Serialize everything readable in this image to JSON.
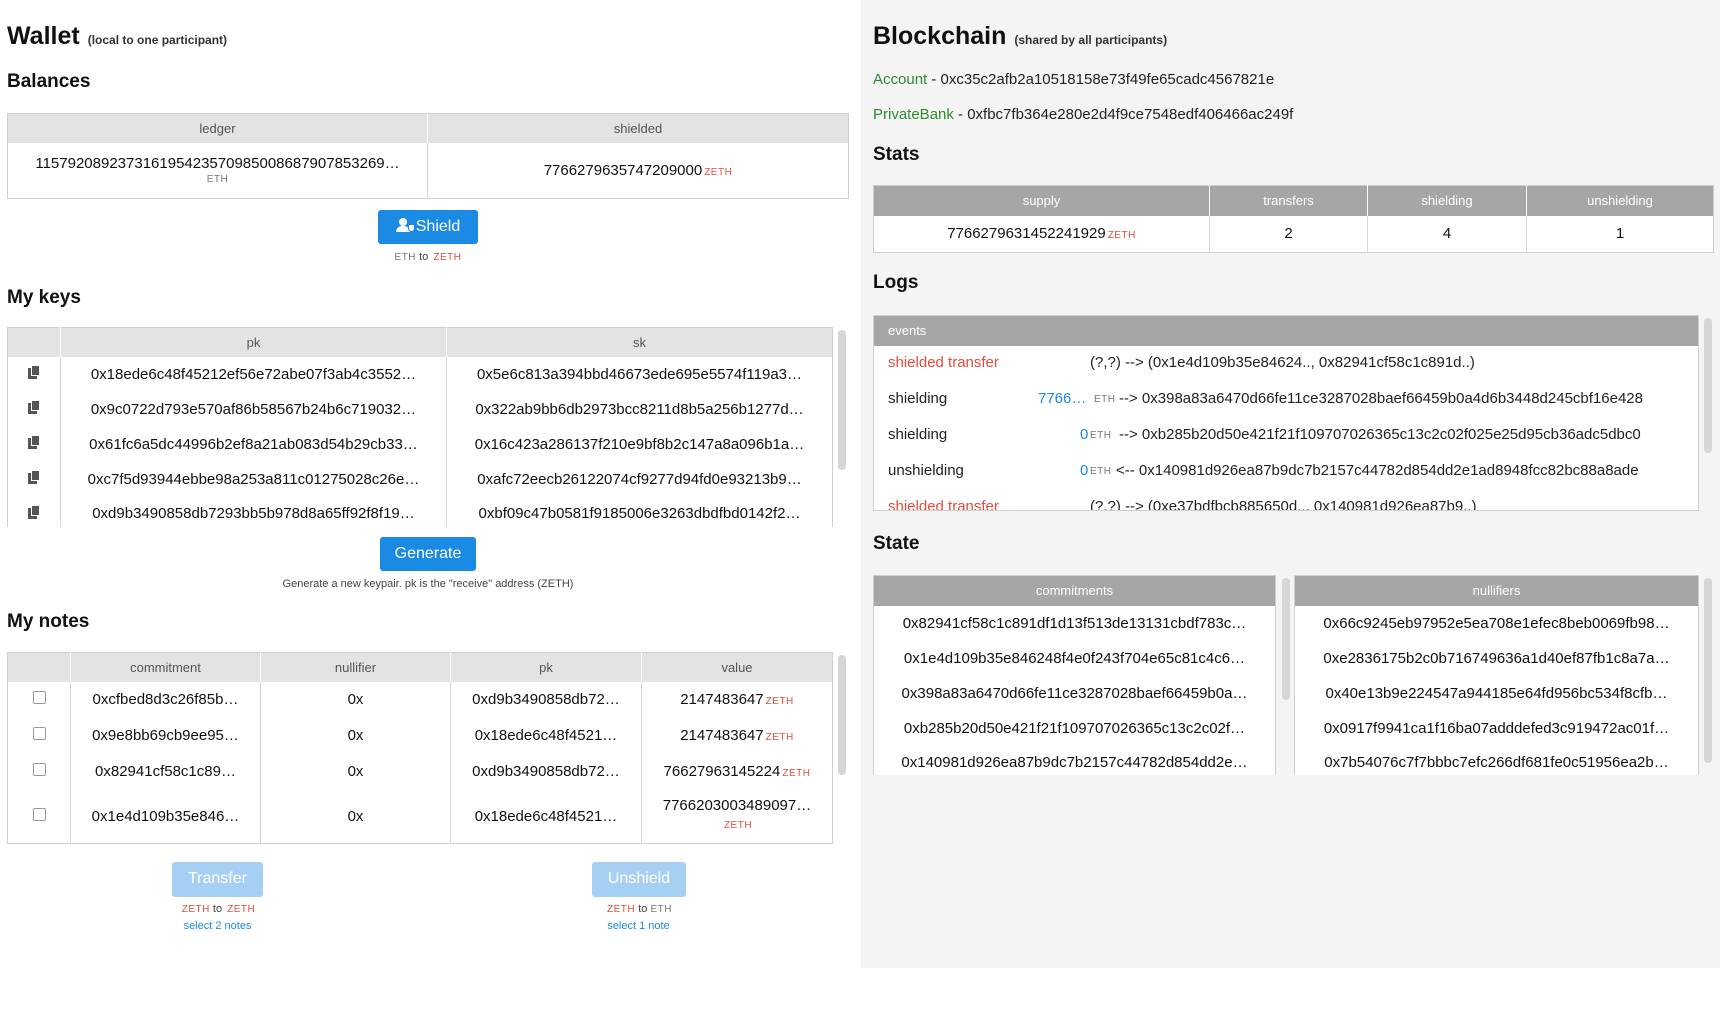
{
  "wallet": {
    "title": "Wallet",
    "subtitle": "(local to one participant)",
    "balances_title": "Balances",
    "balances_headers": [
      "ledger",
      "shielded"
    ],
    "ledger_value": "115792089237316195423570985008687907853269…",
    "ledger_unit": "ETH",
    "shielded_value": "7766279635747209000",
    "shielded_unit": "ZETH",
    "shield_button": "Shield",
    "shield_caption_from": "ETH",
    "shield_caption_to_word": "to",
    "shield_caption_to": "ZETH",
    "keys_title": "My keys",
    "keys_headers": [
      "pk",
      "sk"
    ],
    "keys": [
      {
        "pk": "0x18ede6c48f45212ef56e72abe07f3ab4c3552…",
        "sk": "0x5e6c813a394bbd46673ede695e5574f119a3…"
      },
      {
        "pk": "0x9c0722d793e570af86b58567b24b6c719032…",
        "sk": "0x322ab9bb6db2973bcc8211d8b5a256b1277d…"
      },
      {
        "pk": "0x61fc6a5dc44996b2ef8a21ab083d54b29cb33…",
        "sk": "0x16c423a286137f210e9bf8b2c147a8a096b1a…"
      },
      {
        "pk": "0xc7f5d93944ebbe98a253a811c01275028c26e…",
        "sk": "0xafc72eecb26122074cf9277d94fd0e93213b9…"
      },
      {
        "pk": "0xd9b3490858db7293bb5b978d8a65ff92f8f19…",
        "sk": "0xbf09c47b0581f9185006e3263dbdfbd0142f2…"
      }
    ],
    "generate_button": "Generate",
    "generate_caption": "Generate a new keypair. pk is the \"receive\" address (ZETH)",
    "notes_title": "My notes",
    "notes_headers": [
      "",
      "commitment",
      "nullifier",
      "pk",
      "value"
    ],
    "notes": [
      {
        "commitment": "0xcfbed8d3c26f85b…",
        "nullifier": "0x",
        "pk": "0xd9b3490858db72…",
        "value": "2147483647",
        "unit": "ZETH"
      },
      {
        "commitment": "0x9e8bb69cb9ee95…",
        "nullifier": "0x",
        "pk": "0x18ede6c48f4521…",
        "value": "2147483647",
        "unit": "ZETH"
      },
      {
        "commitment": "0x82941cf58c1c89…",
        "nullifier": "0x",
        "pk": "0xd9b3490858db72…",
        "value": "76627963145224",
        "unit": "ZETH"
      },
      {
        "commitment": "0x1e4d109b35e846…",
        "nullifier": "0x",
        "pk": "0x18ede6c48f4521…",
        "value": "7766203003489097…",
        "unit": "ZETH"
      }
    ],
    "transfer_button": "Transfer",
    "transfer_caption_from": "ZETH",
    "transfer_caption_to": "ZETH",
    "transfer_caption_word": "to",
    "transfer_hint": "select 2 notes",
    "unshield_button": "Unshield",
    "unshield_caption_from": "ZETH",
    "unshield_caption_to": "ETH",
    "unshield_caption_word": "to",
    "unshield_hint": "select 1 note"
  },
  "blockchain": {
    "title": "Blockchain",
    "subtitle": "(shared by all participants)",
    "account_label": "Account",
    "account_value": " - 0xc35c2afb2a10518158e73f49fe65cadc4567821e",
    "bank_label": "PrivateBank",
    "bank_value": " - 0xfbc7fb364e280e2d4f9ce7548edf406466ac249f",
    "stats_title": "Stats",
    "stats_headers": [
      "supply",
      "transfers",
      "shielding",
      "unshielding"
    ],
    "supply": "7766279631452241929",
    "supply_unit": "ZETH",
    "transfers": "2",
    "shielding": "4",
    "unshielding": "1",
    "logs_title": "Logs",
    "events_header": "events",
    "events": [
      {
        "type": "shielded transfer",
        "amount": "",
        "unit": "",
        "detail": "(?,?) --> (0x1e4d109b35e84624..,  0x82941cf58c1c891d..)"
      },
      {
        "type": "shielding",
        "amount": "7766…",
        "unit": "ETH",
        "detail": "--> 0x398a83a6470d66fe11ce3287028baef66459b0a4d6b3448d245cbf16e428"
      },
      {
        "type": "shielding",
        "amount": "0",
        "unit": "ETH",
        "detail": "--> 0xb285b20d50e421f21f109707026365c13c2c02f025e25d95cb36adc5dbc0"
      },
      {
        "type": "unshielding",
        "amount": "0",
        "unit": "ETH",
        "detail": "<-- 0x140981d926ea87b9dc7b2157c44782d854dd2e1ad8948fcc82bc88a8ade"
      },
      {
        "type": "shielded transfer",
        "amount": "",
        "unit": "",
        "detail": "(?,?) --> (0xe37bdfbcb885650d..,  0x140981d926ea87b9..)"
      }
    ],
    "state_title": "State",
    "commitments_header": "commitments",
    "nullifiers_header": "nullifiers",
    "commitments": [
      "0x82941cf58c1c891df1d13f513de13131cbdf783c…",
      "0x1e4d109b35e846248f4e0f243f704e65c81c4c6…",
      "0x398a83a6470d66fe11ce3287028baef66459b0a…",
      "0xb285b20d50e421f21f109707026365c13c2c02f…",
      "0x140981d926ea87b9dc7b2157c44782d854dd2e…"
    ],
    "nullifiers": [
      "0x66c9245eb97952e5ea708e1efec8beb0069fb98…",
      "0xe2836175b2c0b716749636a1d40ef87fb1c8a7a…",
      "0x40e13b9e224547a944185e64fd956bc534f8cfb…",
      "0x0917f9941ca1f16ba07adddefed3c919472ac01f…",
      "0x7b54076c7f7bbbc7efc266df681fe0c51956ea2b…"
    ]
  },
  "colors": {
    "accent": "#1b8ae5",
    "zeth": "#e44d3a",
    "green": "#2f8a2f",
    "panel": "#f4f4f4"
  }
}
